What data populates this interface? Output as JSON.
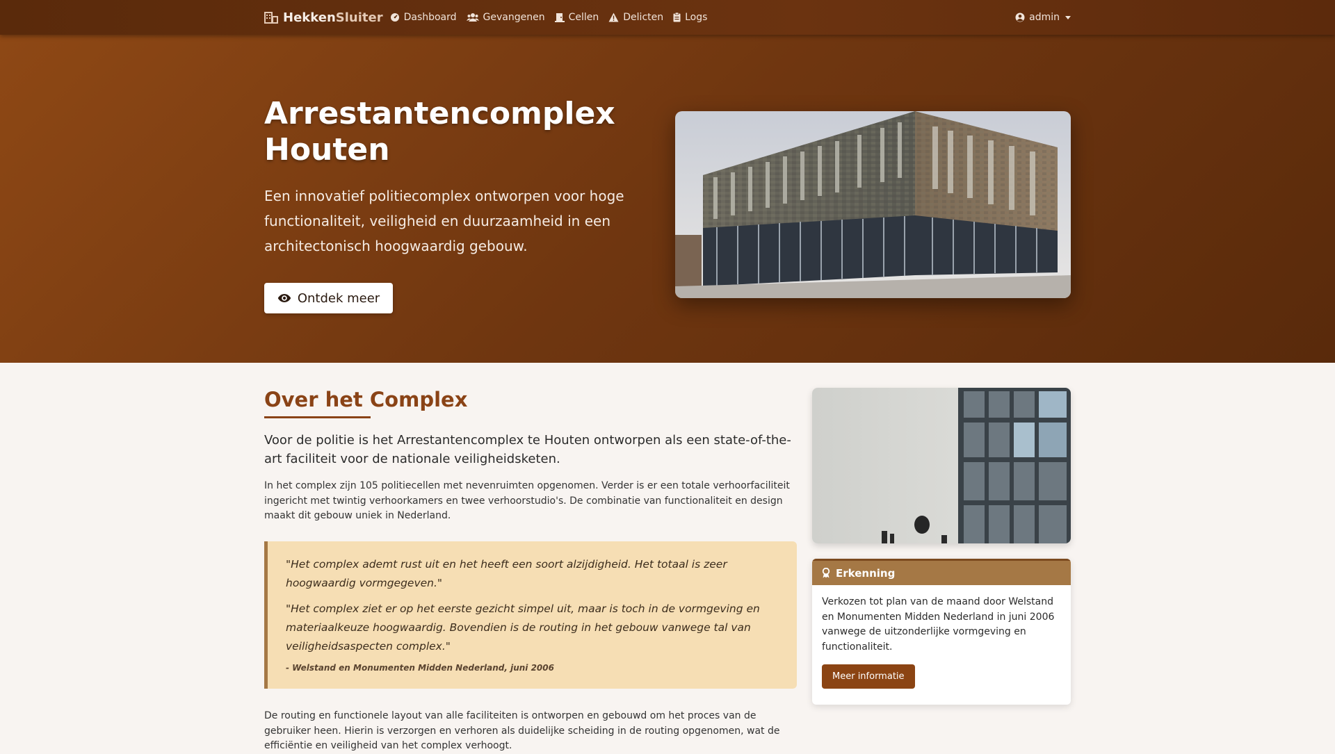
{
  "nav": {
    "brand_part1": "Hekken",
    "brand_part2": "Sluiter",
    "links": [
      {
        "label": "Dashboard",
        "icon": "dashboard-icon"
      },
      {
        "label": "Gevangenen",
        "icon": "users-icon"
      },
      {
        "label": "Cellen",
        "icon": "door-icon"
      },
      {
        "label": "Delicten",
        "icon": "warning-icon"
      },
      {
        "label": "Logs",
        "icon": "clipboard-icon"
      }
    ],
    "user": "admin"
  },
  "hero": {
    "title": "Arrestantencomplex Houten",
    "lead": "Een innovatief politiecomplex ontworpen voor hoge functionaliteit, veiligheid en duurzaamheid in een architectonisch hoogwaardig gebouw.",
    "button_label": "Ontdek meer"
  },
  "about": {
    "title": "Over het Complex",
    "lead": "Voor de politie is het Arrestantencomplex te Houten ontworpen als een state-of-the-art faciliteit voor de nationale veiligheidsketen.",
    "paragraph1": "In het complex zijn 105 politiecellen met nevenruimten opgenomen. Verder is er een totale verhoorfaciliteit ingericht met twintig verhoorkamers en twee verhoorstudio's. De combinatie van functionaliteit en design maakt dit gebouw uniek in Nederland.",
    "quote1": "\"Het complex ademt rust uit en het heeft een soort alzijdigheid. Het totaal is zeer hoogwaardig vormgegeven.\"",
    "quote2": "\"Het complex ziet er op het eerste gezicht simpel uit, maar is toch in de vormgeving en materiaalkeuze hoogwaardig. Bovendien is de routing in het gebouw vanwege tal van veiligheidsaspecten complex.\"",
    "quote_cite": "- Welstand en Monumenten Midden Nederland, juni 2006",
    "paragraph2": "De routing en functionele layout van alle faciliteiten is ontworpen en gebouwd om het proces van de gebruiker heen. Hierin is verzorgen en verhoren als duidelijke scheiding in de routing opgenomen, wat de efficiëntie en veiligheid van het complex verhoogt."
  },
  "card": {
    "title": "Erkenning",
    "text": "Verkozen tot plan van de maand door Welstand en Monumenten Midden Nederland in juni 2006 vanwege de uitzonderlijke vormgeving en functionaliteit.",
    "button_label": "Meer informatie"
  },
  "colors": {
    "navbar": "#5a2a0b",
    "hero": "#7a3c12",
    "accent": "#8a4316",
    "quote_bg": "#f6deb4",
    "card_head": "#a57845"
  }
}
